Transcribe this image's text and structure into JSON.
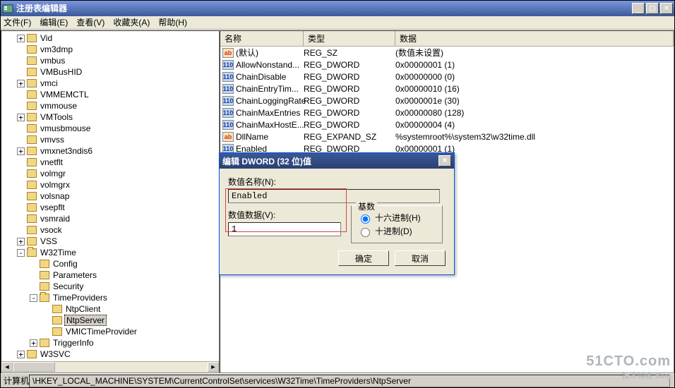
{
  "window": {
    "title": "注册表编辑器",
    "min": "_",
    "max": "□",
    "close": "×"
  },
  "menu": {
    "file": "文件(F)",
    "edit": "编辑(E)",
    "view": "查看(V)",
    "fav": "收藏夹(A)",
    "help": "帮助(H)"
  },
  "tree": [
    {
      "d": 1,
      "exp": "+",
      "label": "Vid"
    },
    {
      "d": 1,
      "exp": "",
      "label": "vm3dmp"
    },
    {
      "d": 1,
      "exp": "",
      "label": "vmbus"
    },
    {
      "d": 1,
      "exp": "",
      "label": "VMBusHID"
    },
    {
      "d": 1,
      "exp": "+",
      "label": "vmci"
    },
    {
      "d": 1,
      "exp": "",
      "label": "VMMEMCTL"
    },
    {
      "d": 1,
      "exp": "",
      "label": "vmmouse"
    },
    {
      "d": 1,
      "exp": "+",
      "label": "VMTools"
    },
    {
      "d": 1,
      "exp": "",
      "label": "vmusbmouse"
    },
    {
      "d": 1,
      "exp": "",
      "label": "vmvss"
    },
    {
      "d": 1,
      "exp": "+",
      "label": "vmxnet3ndis6"
    },
    {
      "d": 1,
      "exp": "",
      "label": "vnetflt"
    },
    {
      "d": 1,
      "exp": "",
      "label": "volmgr"
    },
    {
      "d": 1,
      "exp": "",
      "label": "volmgrx"
    },
    {
      "d": 1,
      "exp": "",
      "label": "volsnap"
    },
    {
      "d": 1,
      "exp": "",
      "label": "vsepflt"
    },
    {
      "d": 1,
      "exp": "",
      "label": "vsmraid"
    },
    {
      "d": 1,
      "exp": "",
      "label": "vsock"
    },
    {
      "d": 1,
      "exp": "+",
      "label": "VSS"
    },
    {
      "d": 1,
      "exp": "-",
      "label": "W32Time",
      "open": true
    },
    {
      "d": 2,
      "exp": "",
      "label": "Config"
    },
    {
      "d": 2,
      "exp": "",
      "label": "Parameters"
    },
    {
      "d": 2,
      "exp": "",
      "label": "Security"
    },
    {
      "d": 2,
      "exp": "-",
      "label": "TimeProviders",
      "open": true
    },
    {
      "d": 3,
      "exp": "",
      "label": "NtpClient"
    },
    {
      "d": 3,
      "exp": "",
      "label": "NtpServer",
      "sel": true
    },
    {
      "d": 3,
      "exp": "",
      "label": "VMICTimeProvider"
    },
    {
      "d": 2,
      "exp": "+",
      "label": "TriggerInfo"
    },
    {
      "d": 1,
      "exp": "+",
      "label": "W3SVC"
    }
  ],
  "columns": {
    "name": "名称",
    "type": "类型",
    "data": "数据"
  },
  "rows": [
    {
      "icon": "sz",
      "name": "(默认)",
      "type": "REG_SZ",
      "data": "(数值未设置)"
    },
    {
      "icon": "bin",
      "name": "AllowNonstand...",
      "type": "REG_DWORD",
      "data": "0x00000001 (1)"
    },
    {
      "icon": "bin",
      "name": "ChainDisable",
      "type": "REG_DWORD",
      "data": "0x00000000 (0)"
    },
    {
      "icon": "bin",
      "name": "ChainEntryTim...",
      "type": "REG_DWORD",
      "data": "0x00000010 (16)"
    },
    {
      "icon": "bin",
      "name": "ChainLoggingRate",
      "type": "REG_DWORD",
      "data": "0x0000001e (30)"
    },
    {
      "icon": "bin",
      "name": "ChainMaxEntries",
      "type": "REG_DWORD",
      "data": "0x00000080 (128)"
    },
    {
      "icon": "bin",
      "name": "ChainMaxHostE...",
      "type": "REG_DWORD",
      "data": "0x00000004 (4)"
    },
    {
      "icon": "sz",
      "name": "DllName",
      "type": "REG_EXPAND_SZ",
      "data": "%systemroot%\\system32\\w32time.dll"
    },
    {
      "icon": "bin",
      "name": "Enabled",
      "type": "REG_DWORD",
      "data": "0x00000001 (1)"
    }
  ],
  "dialog": {
    "title": "编辑 DWORD (32 位)值",
    "close": "×",
    "name_label": "数值名称(N):",
    "name_value": "Enabled",
    "data_label": "数值数据(V):",
    "data_value": "1",
    "base_legend": "基数",
    "radio_hex": "十六进制(H)",
    "radio_dec": "十进制(D)",
    "ok": "确定",
    "cancel": "取消"
  },
  "status": {
    "prefix": "计算机",
    "path": "\\HKEY_LOCAL_MACHINE\\SYSTEM\\CurrentControlSet\\services\\W32Time\\TimeProviders\\NtpServer"
  },
  "watermark": {
    "big": "51CTO.com",
    "small": "技术博客    Blog"
  }
}
